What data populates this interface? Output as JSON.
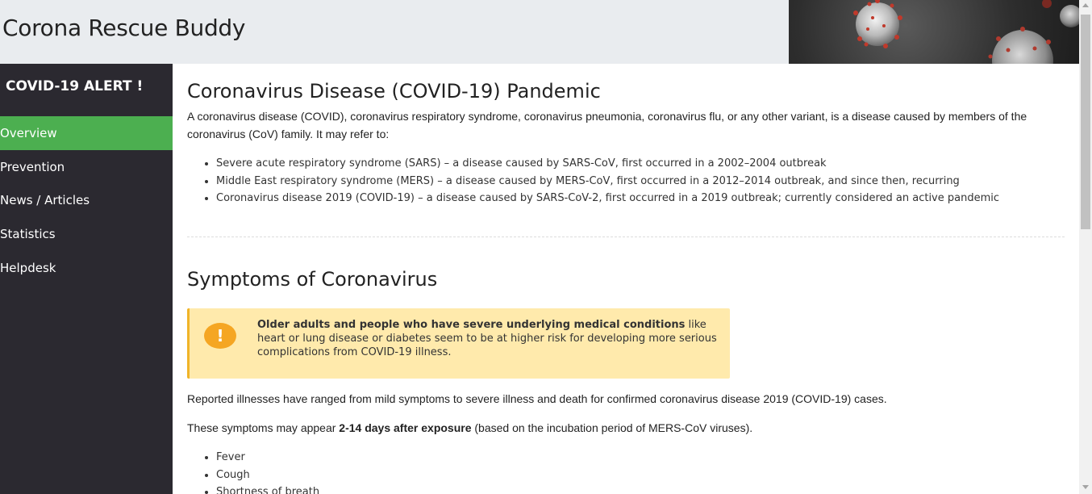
{
  "header": {
    "title": "Corona Rescue Buddy"
  },
  "sidebar": {
    "alert_title": "COVID-19 ALERT !",
    "items": [
      {
        "label": "Overview",
        "active": true
      },
      {
        "label": "Prevention"
      },
      {
        "label": "News / Articles"
      },
      {
        "label": "Statistics"
      },
      {
        "label": "Helpdesk"
      }
    ]
  },
  "main": {
    "section1": {
      "heading": "Coronavirus Disease (COVID-19) Pandemic",
      "intro": "A coronavirus disease (COVID), coronavirus respiratory syndrome, coronavirus pneumonia, coronavirus flu, or any other variant, is a disease caused by members of the coronavirus (CoV) family. It may refer to:",
      "list": [
        "Severe acute respiratory syndrome (SARS) – a disease caused by SARS-CoV, first occurred in a 2002–2004 outbreak",
        "Middle East respiratory syndrome (MERS) – a disease caused by MERS-CoV, first occurred in a 2012–2014 outbreak, and since then, recurring",
        "Coronavirus disease 2019 (COVID-19) – a disease caused by SARS-CoV-2, first occurred in a 2019 outbreak; currently considered an active pandemic"
      ]
    },
    "section2": {
      "heading": "Symptoms of Coronavirus",
      "warning": {
        "bold": "Older adults and people who have severe underlying medical conditions",
        "rest": " like heart or lung disease or diabetes seem to be at higher risk for developing more serious complications from COVID-19 illness.",
        "icon": "!"
      },
      "para1": "Reported illnesses have ranged from mild symptoms to severe illness and death for confirmed coronavirus disease 2019 (COVID-19) cases.",
      "para2_pre": "These symptoms may appear ",
      "para2_bold": "2-14 days after exposure",
      "para2_post": " (based on the incubation period of MERS-CoV viruses).",
      "symptoms": [
        "Fever",
        "Cough",
        "Shortness of breath"
      ]
    }
  },
  "colors": {
    "header_bg": "#e9ecef",
    "sidebar_bg": "#2b2930",
    "active_nav": "#4caf50",
    "warning_bg": "#ffeaac",
    "warning_icon": "#f5a623"
  },
  "icons": {
    "warning": "warning-icon",
    "banner": "coronavirus-banner-image"
  }
}
